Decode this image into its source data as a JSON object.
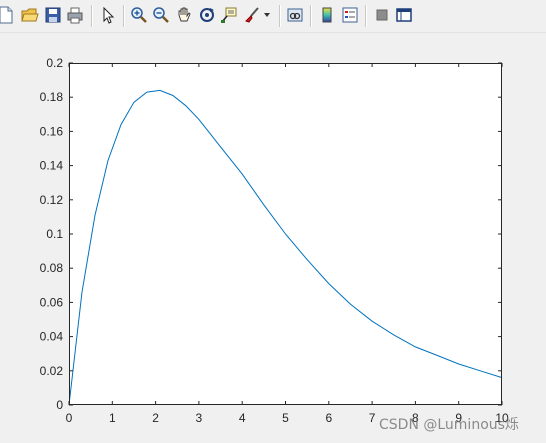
{
  "toolbar": {
    "icons": [
      "new-figure-icon",
      "open-file-icon",
      "save-icon",
      "print-icon",
      "select-arrow-icon",
      "zoom-in-icon",
      "zoom-out-icon",
      "pan-hand-icon",
      "rotate-3d-icon",
      "data-cursor-icon",
      "brush-icon",
      "brush-dropdown-icon",
      "link-plot-icon",
      "colorbar-icon",
      "legend-icon",
      "hide-plot-tools-icon",
      "show-plot-tools-icon"
    ]
  },
  "watermark": "CSDN @Luminous烁",
  "colors": {
    "line": "#0072bd",
    "axes_bg": "#ffffff",
    "figure_bg": "#f0f0f0",
    "axis": "#262626"
  },
  "chart_data": {
    "type": "line",
    "title": "",
    "xlabel": "",
    "ylabel": "",
    "xlim": [
      0,
      10
    ],
    "ylim": [
      0,
      0.2
    ],
    "grid": false,
    "x_ticks": [
      "0",
      "1",
      "2",
      "3",
      "4",
      "5",
      "6",
      "7",
      "8",
      "9",
      "10"
    ],
    "y_ticks": [
      "0",
      "0.02",
      "0.04",
      "0.06",
      "0.08",
      "0.1",
      "0.12",
      "0.14",
      "0.16",
      "0.18",
      "0.2"
    ],
    "series": [
      {
        "x": [
          0,
          0.3,
          0.6,
          0.9,
          1.2,
          1.5,
          1.8,
          2.1,
          2.4,
          2.7,
          3.0,
          3.5,
          4.0,
          4.5,
          5.0,
          5.5,
          6.0,
          6.5,
          7.0,
          7.5,
          8.0,
          8.5,
          9.0,
          9.5,
          10.0
        ],
        "y": [
          0,
          0.066,
          0.111,
          0.143,
          0.164,
          0.177,
          0.183,
          0.184,
          0.181,
          0.175,
          0.167,
          0.151,
          0.135,
          0.117,
          0.1,
          0.085,
          0.071,
          0.059,
          0.049,
          0.041,
          0.034,
          0.029,
          0.024,
          0.02,
          0.016
        ]
      }
    ]
  }
}
